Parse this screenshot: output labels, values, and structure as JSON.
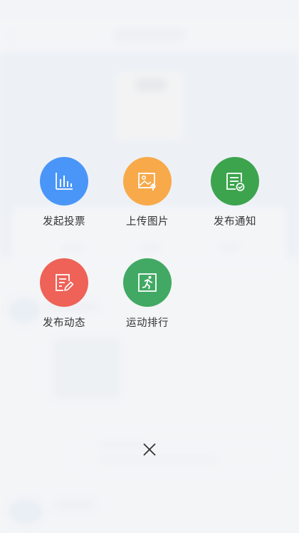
{
  "actions": [
    {
      "label": "发起投票",
      "icon": "bar-chart-icon",
      "color": "#4a96f8"
    },
    {
      "label": "上传图片",
      "icon": "image-upload-icon",
      "color": "#f8a94a"
    },
    {
      "label": "发布通知",
      "icon": "notice-check-icon",
      "color": "#3da44e"
    },
    {
      "label": "发布动态",
      "icon": "edit-post-icon",
      "color": "#ee6258"
    },
    {
      "label": "运动排行",
      "icon": "running-icon",
      "color": "#41a963"
    }
  ],
  "close": {
    "icon": "close-icon"
  }
}
